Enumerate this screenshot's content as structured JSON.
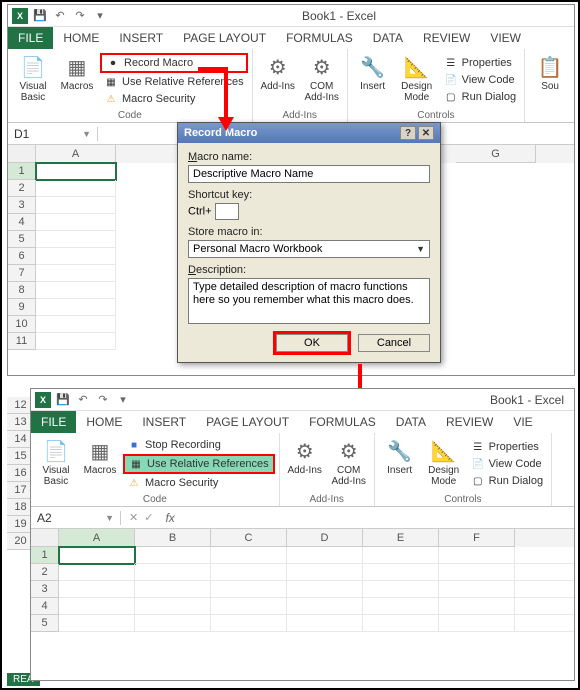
{
  "app": {
    "title": "Book1 - Excel",
    "title2": "Book1 - Excel"
  },
  "qat": {
    "save": "💾",
    "undo": "↶",
    "redo": "↷",
    "dd": "▾"
  },
  "tabs": {
    "file": "FILE",
    "home": "HOME",
    "insert": "INSERT",
    "page": "PAGE LAYOUT",
    "formulas": "FORMULAS",
    "data": "DATA",
    "review": "REVIEW",
    "view": "VIEW",
    "view2": "VIE"
  },
  "ribbon_top": {
    "visual_basic": "Visual\nBasic",
    "macros": "Macros",
    "record_macro": "Record Macro",
    "use_rel": "Use Relative References",
    "macro_sec": "Macro Security",
    "code_grp": "Code",
    "addins": "Add-Ins",
    "com": "COM\nAdd-Ins",
    "addins_grp": "Add-Ins",
    "insert": "Insert",
    "design": "Design\nMode",
    "properties": "Properties",
    "view_code": "View Code",
    "run_dialog": "Run Dialog",
    "controls_grp": "Controls",
    "source": "Sou"
  },
  "ribbon_bot": {
    "stop_rec": "Stop Recording",
    "use_rel": "Use Relative References"
  },
  "fx": {
    "d1": "D1",
    "a2": "A2",
    "fx": "fx",
    "x": "✕",
    "chk": "✓"
  },
  "cols_top": [
    "A",
    "G"
  ],
  "cols_bot": [
    "A",
    "B",
    "C",
    "D",
    "E",
    "F"
  ],
  "rows_top": [
    "1",
    "2",
    "3",
    "4",
    "5",
    "6",
    "7",
    "8",
    "9",
    "10",
    "11"
  ],
  "rows_bot_left": [
    "12",
    "13",
    "14",
    "15",
    "16",
    "17",
    "18",
    "19",
    "20"
  ],
  "rows_bot": [
    "1",
    "2",
    "3",
    "4",
    "5"
  ],
  "sheet_tab": "REA",
  "dialog": {
    "title": "Record Macro",
    "name_lbl": "Macro name:",
    "name_val": "Descriptive Macro Name",
    "shortcut_lbl": "Shortcut key:",
    "ctrl": "Ctrl+",
    "store_lbl": "Store macro in:",
    "store_val": "Personal Macro Workbook",
    "desc_lbl": "Description:",
    "desc_val": "Type detailed description of macro functions here so you remember what this macro does.",
    "ok": "OK",
    "cancel": "Cancel",
    "help": "?",
    "close": "✕"
  }
}
